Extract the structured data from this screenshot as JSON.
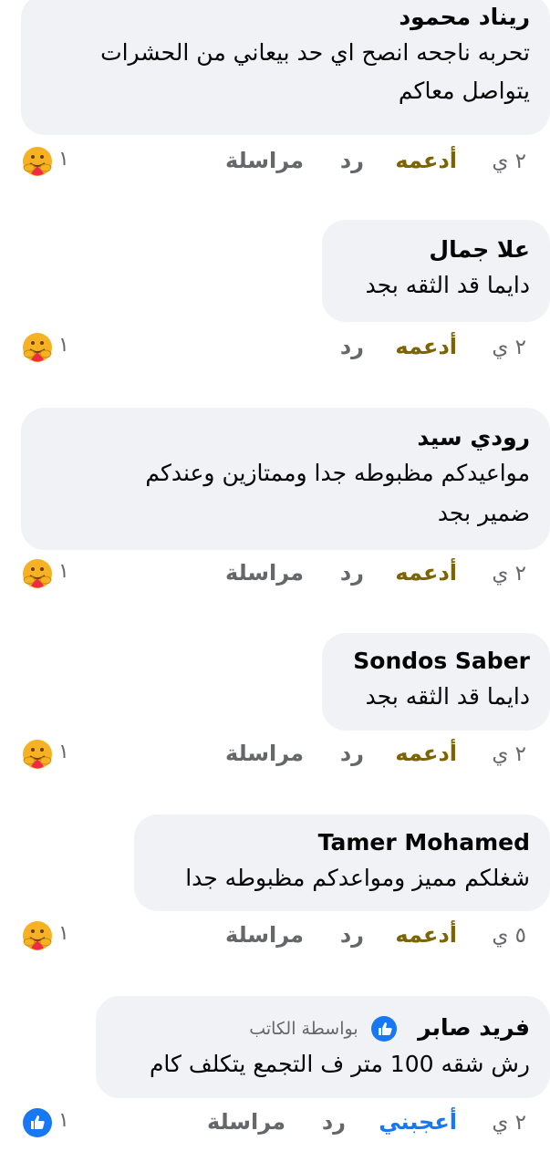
{
  "comments": [
    {
      "name": "ريناد محمود",
      "lines": [
        "تحربه ناجحه انصح اي حد بيعاني من الحشرات",
        "يتواصل معاكم"
      ],
      "time": "٢ ي",
      "like_label": "أدعمه",
      "reply_label": "رد",
      "message_label": "مراسلة",
      "reaction_count": "١",
      "reaction": "care"
    },
    {
      "name": "علا جمال",
      "lines": [
        "دايما قد الثقه بجد"
      ],
      "time": "٢ ي",
      "like_label": "أدعمه",
      "reply_label": "رد",
      "message_label": "",
      "reaction_count": "١",
      "reaction": "care"
    },
    {
      "name": "رودي سيد",
      "lines": [
        "مواعيدكم مظبوطه جدا وممتازين  وعندكم",
        "ضمير بجد"
      ],
      "time": "٢ ي",
      "like_label": "أدعمه",
      "reply_label": "رد",
      "message_label": "مراسلة",
      "reaction_count": "١",
      "reaction": "care"
    },
    {
      "name": "Sondos Saber",
      "lines": [
        "دايما قد الثقه بجد"
      ],
      "time": "٢ ي",
      "like_label": "أدعمه",
      "reply_label": "رد",
      "message_label": "مراسلة",
      "reaction_count": "١",
      "reaction": "care"
    },
    {
      "name": "Tamer Mohamed",
      "lines": [
        "شغلكم مميز ومواعدكم مظبوطه جدا"
      ],
      "time": "٥ ي",
      "like_label": "أدعمه",
      "reply_label": "رد",
      "message_label": "مراسلة",
      "reaction_count": "١",
      "reaction": "care"
    },
    {
      "name": "فريد صابر",
      "author_label": "بواسطة الكاتب",
      "lines": [
        "رش شقه 100 متر ف التجمع يتكلف كام"
      ],
      "time": "٢ ي",
      "like_label": "أعجبني",
      "reply_label": "رد",
      "message_label": "مراسلة",
      "reaction_count": "١",
      "reaction": "like"
    }
  ],
  "colors": {
    "bubble": "#f0f2f5",
    "support": "#7e6400",
    "like": "#1877f2",
    "meta": "#65676b"
  },
  "icons": {
    "care": "care-reaction-icon",
    "like": "like-reaction-icon",
    "author": "verified-author-icon"
  }
}
